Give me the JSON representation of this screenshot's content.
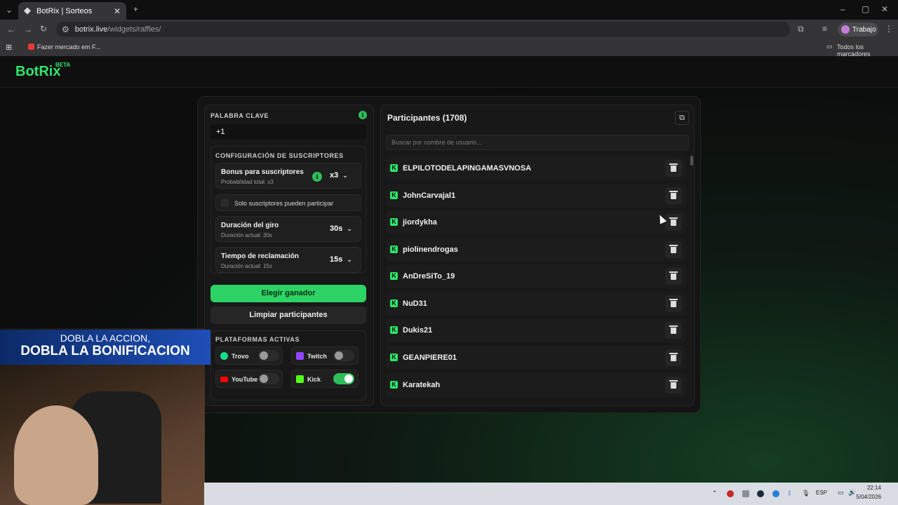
{
  "browser": {
    "tab_title": "BotRix | Sorteos",
    "url_host": "botrix.live",
    "url_path": "/widgets/raffles/",
    "bookmark": "Fazer mercado em F...",
    "all_bookmarks": "Todos los marcadores",
    "profile": "Trabajo"
  },
  "app": {
    "logo": "BotRix",
    "beta": "BETA"
  },
  "keyword": {
    "label": "PALABRA CLAVE",
    "value": "+1"
  },
  "subs": {
    "label": "CONFIGURACIÓN DE SUSCRIPTORES",
    "bonus_title": "Bonus para suscriptores",
    "bonus_sub": "Probabilidad total: x3",
    "bonus_value": "x3",
    "only_subs": "Solo suscriptores pueden participar",
    "spin_title": "Duración del giro",
    "spin_sub": "Duración actual: 30s",
    "spin_value": "30s",
    "claim_title": "Tiempo de reclamación",
    "claim_sub": "Duración actual: 15s",
    "claim_value": "15s"
  },
  "buttons": {
    "pick": "Elegir ganador",
    "clear": "Limpiar participantes"
  },
  "platforms": {
    "label": "PLATAFORMAS ACTIVAS",
    "trovo": "Trovo",
    "twitch": "Twitch",
    "youtube": "YouTube",
    "kick": "Kick"
  },
  "participants": {
    "title": "Participantes (1708)",
    "search_placeholder": "Buscar por nombre de usuario...",
    "list": [
      "ELPILOTODELAPINGAMASVNOSA",
      "JohnCarvajal1",
      "jiordykha",
      "piolinendrogas",
      "AnDreSiTo_19",
      "NuD31",
      "Dukis21",
      "GEANPIERE01",
      "Karatekah"
    ]
  },
  "overlay": {
    "line1": "DOBLA LA ACCION,",
    "line2": "DOBLA LA BONIFICACION"
  },
  "taskbar": {
    "lang": "ESP",
    "time": "22:14",
    "date": "5/04/2026"
  },
  "colors": {
    "accent": "#2ee66b",
    "kick": "#53fc18",
    "trovo": "#1bdb8c",
    "twitch": "#9146ff",
    "youtube": "#ff0000"
  }
}
